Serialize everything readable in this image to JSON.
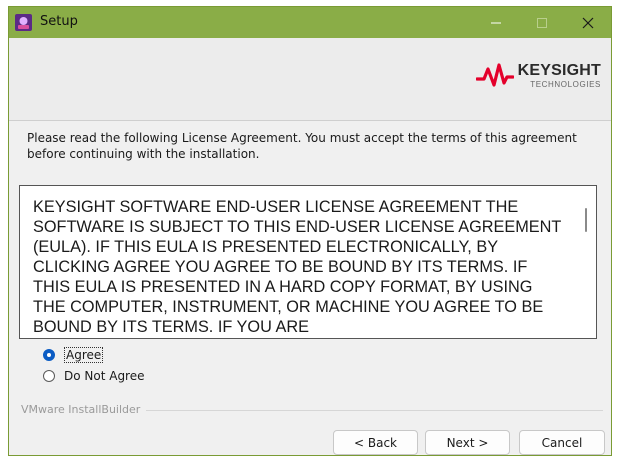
{
  "window": {
    "title": "Setup"
  },
  "branding": {
    "logo_name": "KEYSIGHT",
    "logo_sub": "TECHNOLOGIES",
    "accent": "#e4002b"
  },
  "instructions": "Please read the following License Agreement. You must accept the terms of this agreement before continuing with the installation.",
  "license": {
    "text": "KEYSIGHT SOFTWARE END-USER LICENSE AGREEMENT THE SOFTWARE IS SUBJECT TO THIS END-USER LICENSE AGREEMENT (EULA). IF THIS EULA IS PRESENTED ELECTRONICALLY, BY CLICKING AGREE YOU AGREE TO BE BOUND BY ITS TERMS. IF THIS EULA IS PRESENTED IN A HARD COPY FORMAT, BY USING THE COMPUTER, INSTRUMENT, OR MACHINE YOU AGREE TO BE BOUND BY ITS TERMS. IF YOU ARE"
  },
  "options": {
    "agree": "Agree",
    "disagree": "Do Not Agree",
    "selected": "agree"
  },
  "footer": {
    "builder": "VMware InstallBuilder"
  },
  "buttons": {
    "back": "< Back",
    "next": "Next >",
    "cancel": "Cancel"
  },
  "colors": {
    "titlebar": "#8aad47",
    "radio_selected": "#0b5cc4"
  }
}
